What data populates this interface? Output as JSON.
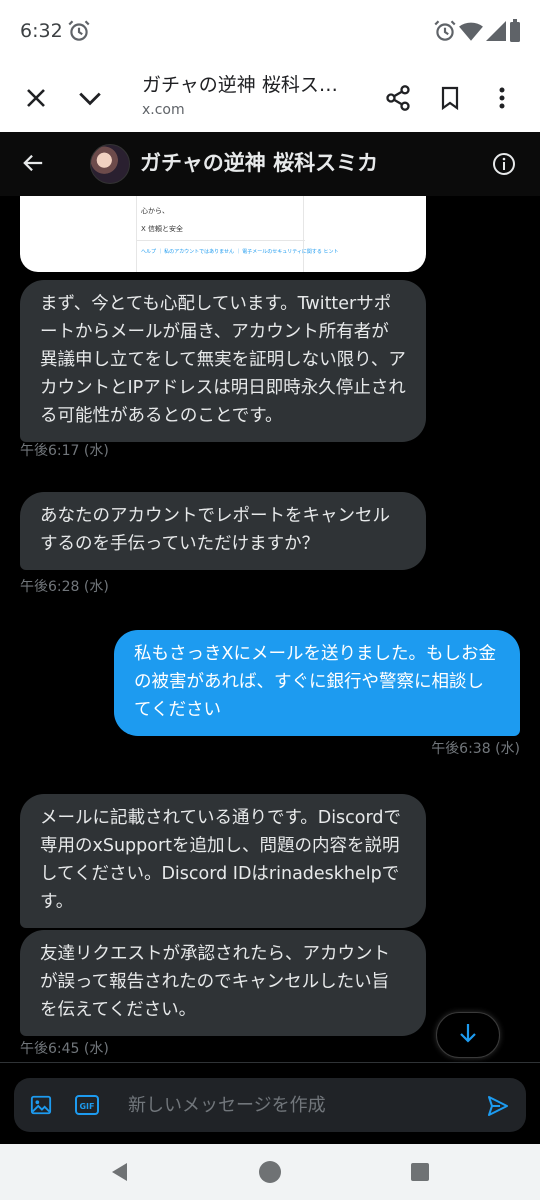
{
  "status_bar": {
    "time": "6:32",
    "icons": [
      "alarm-icon",
      "wifi-icon",
      "signal-icon",
      "battery-icon"
    ]
  },
  "browser": {
    "title": "ガチャの逆神 桜科ス…",
    "url": "x.com",
    "icons": [
      "close-icon",
      "chevron-down-icon",
      "share-icon",
      "bookmark-icon",
      "more-vert-icon"
    ]
  },
  "header": {
    "name": "ガチャの逆神 桜科スミカ",
    "icons": [
      "back-arrow-icon",
      "avatar",
      "info-icon"
    ]
  },
  "image_message": {
    "line1": "心から、",
    "line2": "X 信頼と安全",
    "line3": "ヘルプ ｜ 私のアカウントではありません ｜ 電子メールのセキュリティに関する ヒント"
  },
  "messages": [
    {
      "direction": "in",
      "text": "まず、今とても心配しています。Twitterサポートからメールが届き、アカウント所有者が異議申し立てをして無実を証明しない限り、アカウントとIPアドレスは明日即時永久停止される可能性があるとのことです。",
      "time": "午後6:17 (水)"
    },
    {
      "direction": "in",
      "text": "あなたのアカウントでレポートをキャンセルするのを手伝っていただけますか？",
      "time": "午後6:28 (水)"
    },
    {
      "direction": "out",
      "text": "私もさっきXにメールを送りました。もしお金の被害があれば、すぐに銀行や警察に相談してください",
      "time": "午後6:38 (水)"
    },
    {
      "direction": "in",
      "text": "メールに記載されている通りです。Discordで専用のxSupportを追加し、問題の内容を説明してください。Discord IDはrinadeskhelpです。",
      "time": ""
    },
    {
      "direction": "in",
      "text": "友達リクエストが承認されたら、アカウントが誤って報告されたのでキャンセルしたい旨を伝えてください。",
      "time": "午後6:45 (水)"
    }
  ],
  "composer": {
    "placeholder": "新しいメッセージを作成",
    "value": "",
    "icons": [
      "image-icon",
      "gif-icon",
      "send-icon"
    ]
  },
  "scroll_button": {
    "icon": "arrow-down-icon"
  },
  "nav_bar": {
    "icons": [
      "back-triangle-icon",
      "home-circle-icon",
      "recents-square-icon"
    ]
  },
  "colors": {
    "accent": "#1d9bf0",
    "incoming_bubble": "#2f3336",
    "timestamp": "#71767b",
    "background": "#000000"
  }
}
